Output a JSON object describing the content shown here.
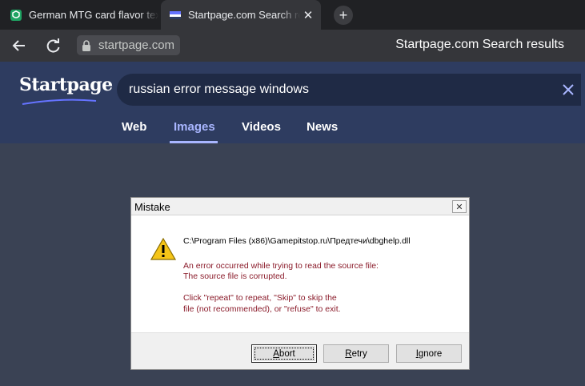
{
  "browser": {
    "tabs": [
      {
        "title": "German MTG card flavor text",
        "favicon": "green-shield-icon"
      },
      {
        "title": "Startpage.com Search results",
        "favicon": "startpage-flag-icon",
        "active": true
      }
    ],
    "url": "startpage.com",
    "page_title": "Startpage.com Search results"
  },
  "startpage": {
    "logo": "Startpage",
    "query": "russian error message windows",
    "nav": [
      "Web",
      "Images",
      "Videos",
      "News"
    ],
    "active_nav": "Images"
  },
  "dialog": {
    "title": "Mistake",
    "path": "C:\\Program Files (x86)\\Gamepitstop.ru\\Предтечи\\dbghelp.dll",
    "error_lines": [
      "An error occurred while trying to read the source file:",
      "The source file is corrupted.",
      "Click \"repeat\" to repeat, \"Skip\" to skip the",
      "file (not recommended), or \"refuse\" to exit."
    ],
    "buttons": [
      {
        "prefix": "",
        "mnemonic": "A",
        "rest": "bort"
      },
      {
        "prefix": "",
        "mnemonic": "R",
        "rest": "etry"
      },
      {
        "prefix": "",
        "mnemonic": "I",
        "rest": "gnore"
      }
    ]
  },
  "colors": {
    "tabstrip": "#202124",
    "toolbar": "#35363a",
    "header": "#2e3c60",
    "content": "#3a4254",
    "active_nav": "#a9b6ff",
    "error_text": "#8b1c2b"
  }
}
